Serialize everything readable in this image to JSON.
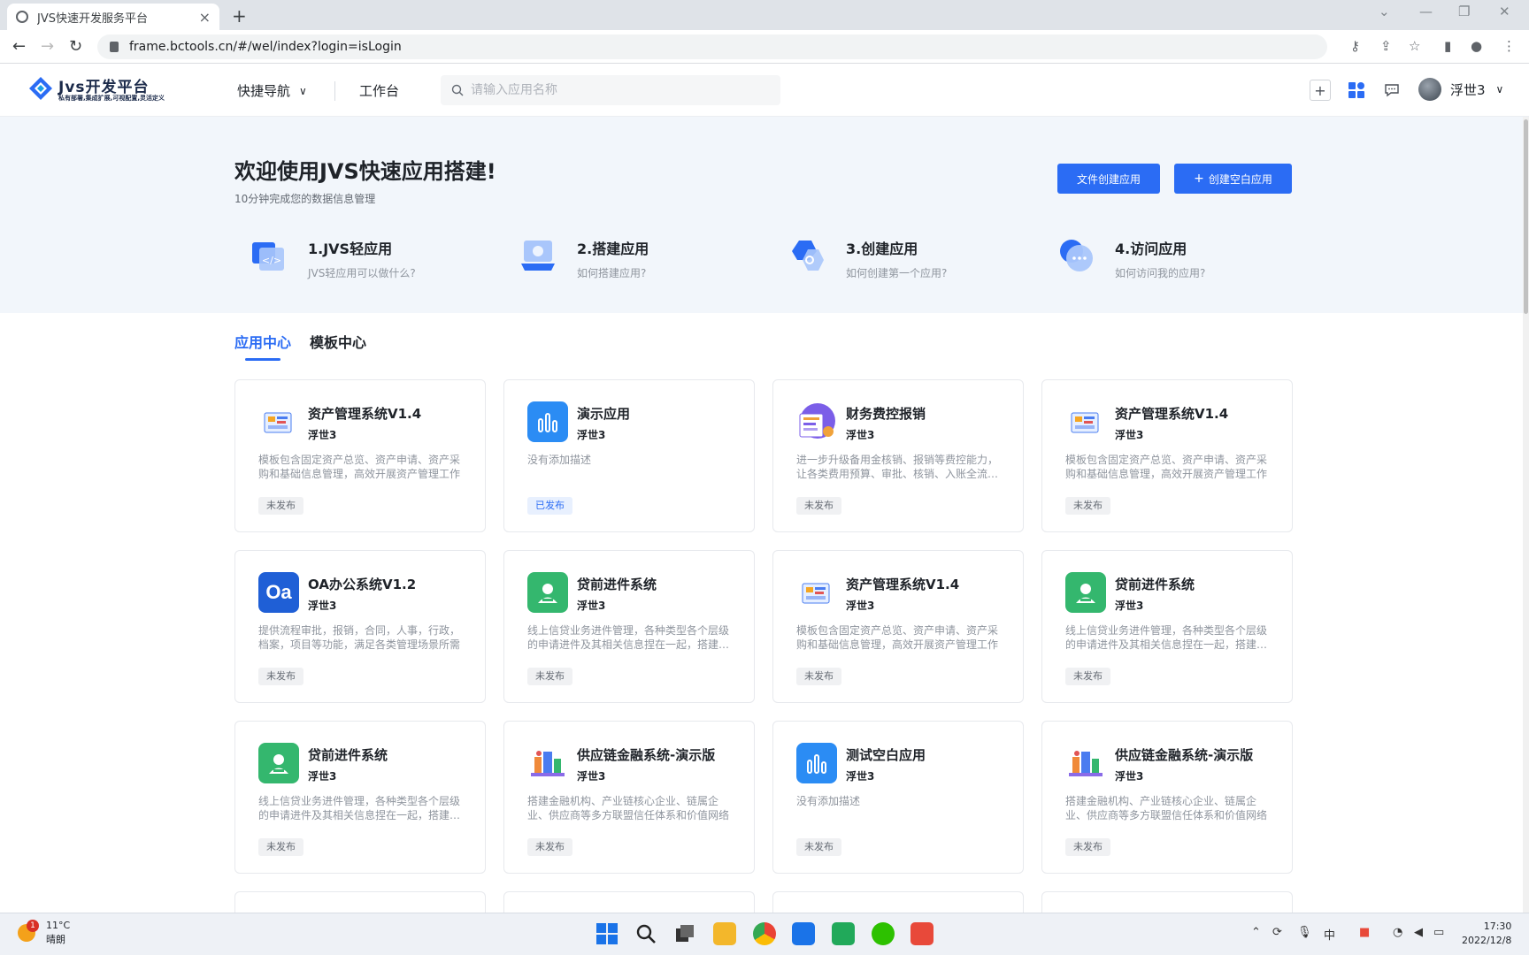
{
  "browser": {
    "tab_title": "JVS快速开发服务平台",
    "url": "frame.bctools.cn/#/wel/index?login=isLogin"
  },
  "header": {
    "logo_title": "Jvs开发平台",
    "logo_subtitle": "私有部署,集成扩展,可视配置,灵活定义",
    "quick_nav": "快捷导航",
    "workbench": "工作台",
    "search_placeholder": "请输入应用名称",
    "username": "浮世3"
  },
  "hero": {
    "title": "欢迎使用JVS快速应用搭建!",
    "subtitle": "10分钟完成您的数据信息管理",
    "btn_file_create": "文件创建应用",
    "btn_blank_create": "创建空白应用",
    "steps": [
      {
        "title": "1.JVS轻应用",
        "desc": "JVS轻应用可以做什么?",
        "icon": "code-window-icon"
      },
      {
        "title": "2.搭建应用",
        "desc": "如何搭建应用?",
        "icon": "monitor-icon"
      },
      {
        "title": "3.创建应用",
        "desc": "如何创建第一个应用?",
        "icon": "hexagon-icon"
      },
      {
        "title": "4.访问应用",
        "desc": "如何访问我的应用?",
        "icon": "chat-bubble-icon"
      }
    ]
  },
  "tabs": [
    {
      "label": "应用中心",
      "active": true
    },
    {
      "label": "模板中心",
      "active": false
    }
  ],
  "apps": [
    {
      "name": "资产管理系统V1.4",
      "owner": "浮世3",
      "desc": "模板包含固定资产总览、资产申请、资产采购和基础信息管理，高效开展资产管理工作",
      "status": "未发布",
      "icon": "asset-icon"
    },
    {
      "name": "演示应用",
      "owner": "浮世3",
      "desc": "没有添加描述",
      "status": "已发布",
      "icon": "bar-chart-icon"
    },
    {
      "name": "财务费控报销",
      "owner": "浮世3",
      "desc": "进一步升级备用金核销、报销等费控能力，让各类费用预算、审批、核销、入账全流程管控",
      "status": "未发布",
      "icon": "finance-icon"
    },
    {
      "name": "资产管理系统V1.4",
      "owner": "浮世3",
      "desc": "模板包含固定资产总览、资产申请、资产采购和基础信息管理，高效开展资产管理工作",
      "status": "未发布",
      "icon": "asset-icon"
    },
    {
      "name": "OA办公系统V1.2",
      "owner": "浮世3",
      "desc": "提供流程审批，报销，合同，人事，行政，档案，项目等功能，满足各类管理场景所需",
      "status": "未发布",
      "icon": "oa-icon"
    },
    {
      "name": "贷前进件系统",
      "owner": "浮世3",
      "desc": "线上信贷业务进件管理，各种类型各个层级的申请进件及其相关信息捏在一起，搭建统一平台",
      "status": "未发布",
      "icon": "loan-icon"
    },
    {
      "name": "资产管理系统V1.4",
      "owner": "浮世3",
      "desc": "模板包含固定资产总览、资产申请、资产采购和基础信息管理，高效开展资产管理工作",
      "status": "未发布",
      "icon": "asset-icon"
    },
    {
      "name": "贷前进件系统",
      "owner": "浮世3",
      "desc": "线上信贷业务进件管理，各种类型各个层级的申请进件及其相关信息捏在一起，搭建统一平台",
      "status": "未发布",
      "icon": "loan-icon"
    },
    {
      "name": "贷前进件系统",
      "owner": "浮世3",
      "desc": "线上信贷业务进件管理，各种类型各个层级的申请进件及其相关信息捏在一起，搭建统一平台",
      "status": "未发布",
      "icon": "loan-icon"
    },
    {
      "name": "供应链金融系统-演示版",
      "owner": "浮世3",
      "desc": "搭建金融机构、产业链核心企业、链属企业、供应商等多方联盟信任体系和价值网络",
      "status": "未发布",
      "icon": "supply-chain-icon"
    },
    {
      "name": "测试空白应用",
      "owner": "浮世3",
      "desc": "没有添加描述",
      "status": "未发布",
      "icon": "bar-chart-icon"
    },
    {
      "name": "供应链金融系统-演示版",
      "owner": "浮世3",
      "desc": "搭建金融机构、产业链核心企业、链属企业、供应商等多方联盟信任体系和价值网络",
      "status": "未发布",
      "icon": "supply-chain-icon"
    }
  ],
  "taskbar": {
    "temperature": "11°C",
    "weather": "晴朗",
    "notification_count": "1",
    "time": "17:30",
    "date": "2022/12/8",
    "ime": "中"
  },
  "colors": {
    "primary": "#2b6cf4",
    "hero_bg": "#f2f6fb"
  }
}
